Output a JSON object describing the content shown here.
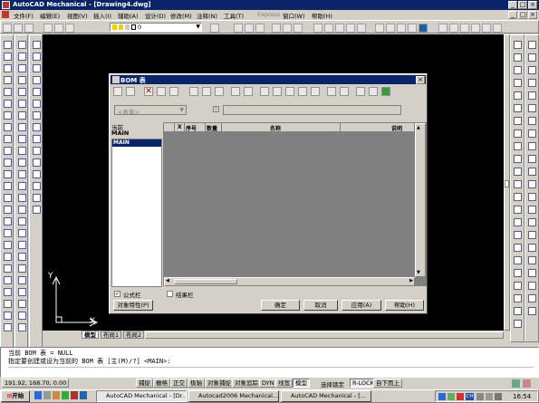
{
  "window": {
    "title": "AutoCAD Mechanical - [Drawing4.dwg]"
  },
  "menu": [
    {
      "label": "文件(F)"
    },
    {
      "label": "编辑(E)"
    },
    {
      "label": "视图(V)"
    },
    {
      "label": "插入(I)"
    },
    {
      "label": "辅助(A)"
    },
    {
      "label": "设计(D)"
    },
    {
      "label": "修改(M)"
    },
    {
      "label": "注释(N)"
    },
    {
      "label": "工具(T)"
    },
    {
      "label": "Express"
    },
    {
      "label": "窗口(W)"
    },
    {
      "label": "帮助(H)"
    }
  ],
  "toolbar": {
    "layer_value": "0"
  },
  "dialog": {
    "title": "BOM 表",
    "filter_placeholder": "<表量>",
    "tree_header": "当前",
    "tree_current": "MAIN",
    "tree_item": "MAIN",
    "columns": [
      "",
      "X",
      "序号",
      "数量",
      "名称",
      "说明"
    ],
    "checkbox_formula": "公式栏",
    "checkbox_formula_checked": true,
    "checkbox_result": "结果栏",
    "checkbox_result_checked": false,
    "object_props_button": "对象特性(P)",
    "ok_button": "确定",
    "cancel_button": "取消",
    "apply_button": "应用(A)",
    "help_button": "帮助(H)"
  },
  "canvas": {
    "ucs_x": "X",
    "ucs_y": "Y"
  },
  "tabs": [
    {
      "label": "模型"
    },
    {
      "label": "布局1"
    },
    {
      "label": "布局2"
    }
  ],
  "command": {
    "line1": "当前 BOM 表 = NULL",
    "line2": "指定要创建或设为当前的 BOM 表 [主(M)/?] <MAIN>:"
  },
  "status": {
    "coords": "191.92, 168.70, 0.00",
    "toggles": [
      {
        "label": "捕捉",
        "on": false
      },
      {
        "label": "栅格",
        "on": false
      },
      {
        "label": "正交",
        "on": false
      },
      {
        "label": "极轴",
        "on": false
      },
      {
        "label": "对象捕捉",
        "on": false
      },
      {
        "label": "对象追踪",
        "on": false
      },
      {
        "label": "DYN",
        "on": false
      },
      {
        "label": "线宽",
        "on": false
      },
      {
        "label": "模型",
        "on": true
      }
    ],
    "lock_label": "选择锁定",
    "rlock": "R-LOCK",
    "direction": "自下而上"
  },
  "taskbar": {
    "start": "开始",
    "tasks": [
      {
        "label": "AutoCAD Mechanical - [Dr..."
      },
      {
        "label": "Autocad2006 Mechanical..."
      },
      {
        "label": "AutoCAD Mechanical - [..."
      }
    ],
    "tray_ch": "CH",
    "clock": "16:54"
  }
}
